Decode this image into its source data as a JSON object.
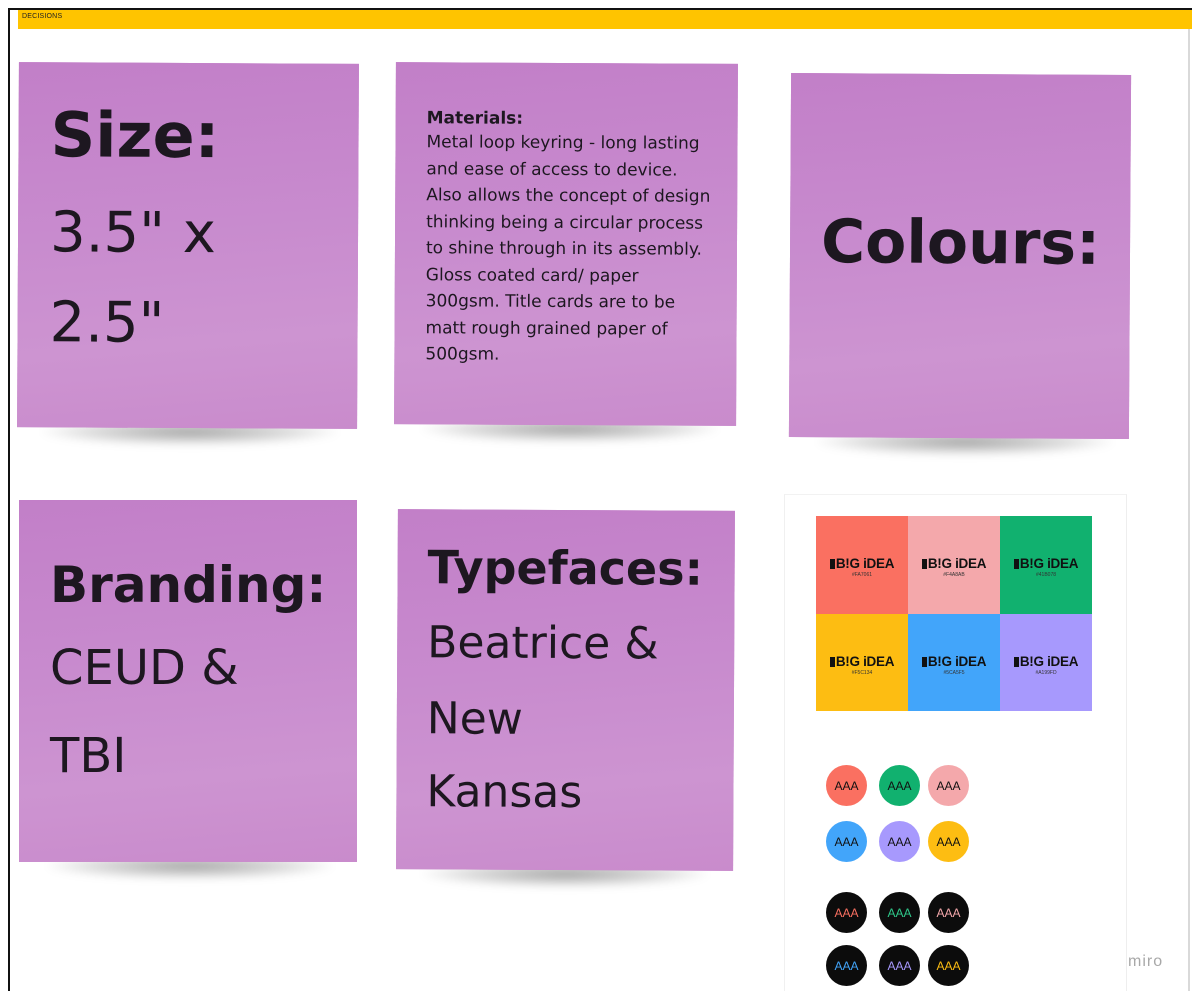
{
  "frame": {
    "title": "DECISIONS",
    "accent": "#ffc400"
  },
  "notes": {
    "size": {
      "heading": "Size:",
      "line1": "3.5\" x",
      "line2": "2.5\""
    },
    "materials": {
      "heading": "Materials:",
      "lines": [
        "Metal loop keyring - long lasting",
        "and ease of access to device.",
        "Also allows the concept of design",
        "thinking being a circular process",
        "to shine through in its assembly.",
        "Gloss coated card/ paper",
        "300gsm. Title cards are to be",
        "matt rough grained paper of",
        "500gsm."
      ]
    },
    "colours": {
      "heading": "Colours:"
    },
    "branding": {
      "heading": "Branding:",
      "line1": "CEUD &",
      "line2": "TBI"
    },
    "typefaces": {
      "heading": "Typefaces:",
      "line1": "Beatrice &",
      "line2": "New",
      "line3": "Kansas"
    },
    "note_color": "#c585cb"
  },
  "palette": {
    "swatches": [
      {
        "logo": "B!G iDEA",
        "hex": "#FA7061",
        "color": "#fa7061"
      },
      {
        "logo": "B!G iDEA",
        "hex": "#F4A8AB",
        "color": "#f4a8ab"
      },
      {
        "logo": "B!G iDEA",
        "hex": "#41B078",
        "color": "#11b16f"
      },
      {
        "logo": "B!G iDEA",
        "hex": "#F5C134",
        "color": "#fdbd12"
      },
      {
        "logo": "B!G iDEA",
        "hex": "#5CA5F5",
        "color": "#42a5fa"
      },
      {
        "logo": "B!G iDEA",
        "hex": "#A199FD",
        "color": "#a799fd"
      }
    ],
    "light_dots": [
      {
        "label": "AAA",
        "bg": "#fa7061",
        "fg": "#111111"
      },
      {
        "label": "AAA",
        "bg": "#11b16f",
        "fg": "#111111"
      },
      {
        "label": "AAA",
        "bg": "#f4a8ab",
        "fg": "#111111"
      },
      {
        "label": "AAA",
        "bg": "#42a5fa",
        "fg": "#111111"
      },
      {
        "label": "AAA",
        "bg": "#a799fd",
        "fg": "#111111"
      },
      {
        "label": "AAA",
        "bg": "#fdbd12",
        "fg": "#111111"
      }
    ],
    "dark_dots": [
      {
        "label": "AAA",
        "bg": "#0c0c0c",
        "fg": "#fa7061"
      },
      {
        "label": "AAA",
        "bg": "#0c0c0c",
        "fg": "#2fc88a"
      },
      {
        "label": "AAA",
        "bg": "#0c0c0c",
        "fg": "#f4a8ab"
      },
      {
        "label": "AAA",
        "bg": "#0c0c0c",
        "fg": "#42a5fa"
      },
      {
        "label": "AAA",
        "bg": "#0c0c0c",
        "fg": "#a799fd"
      },
      {
        "label": "AAA",
        "bg": "#0c0c0c",
        "fg": "#fdbd12"
      }
    ]
  },
  "watermark": "miro"
}
